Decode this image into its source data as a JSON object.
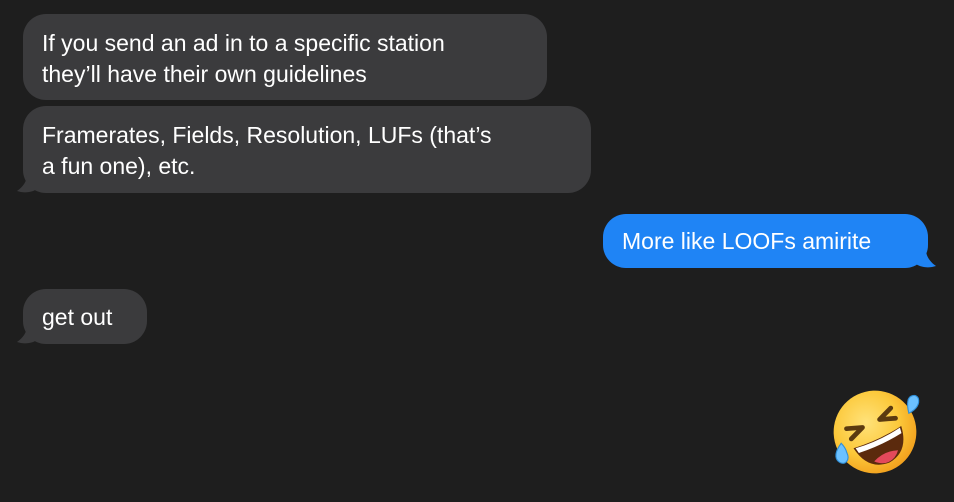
{
  "messages": [
    {
      "direction": "incoming",
      "lines": [
        "If you send an ad in to a specific station",
        "they’ll have their own guidelines"
      ]
    },
    {
      "direction": "incoming",
      "lines": [
        "Framerates, Fields, Resolution, LUFs (that’s",
        "a fun one), etc."
      ]
    },
    {
      "direction": "outgoing",
      "lines": [
        "More like LOOFs amirite"
      ]
    },
    {
      "direction": "incoming",
      "lines": [
        "get out"
      ]
    },
    {
      "direction": "outgoing",
      "emoji": "rolling-on-floor-laughing"
    }
  ],
  "colors": {
    "background": "#1e1e1e",
    "incoming_bubble": "#3b3b3d",
    "outgoing_bubble": "#1f84f5",
    "text": "#ffffff"
  }
}
